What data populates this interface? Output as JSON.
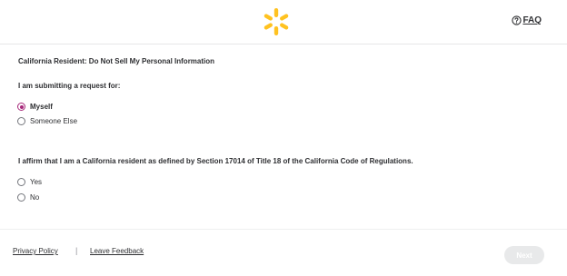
{
  "header": {
    "logo_icon": "walmart-spark-icon",
    "logo_color": "#ffc220",
    "faq_icon": "question-circle-icon",
    "faq_label": "FAQ"
  },
  "form": {
    "title": "California Resident: Do Not Sell My Personal Information",
    "request_question": "I am submitting a request for:",
    "request_options": [
      {
        "label": "Myself",
        "selected": true
      },
      {
        "label": "Someone Else",
        "selected": false
      }
    ],
    "affirm_question": "I affirm that I am a California resident as defined by Section 17014 of Title 18 of the California Code of Regulations.",
    "affirm_options": [
      {
        "label": "Yes",
        "selected": false
      },
      {
        "label": "No",
        "selected": false
      }
    ],
    "accent_color": "#a7287a"
  },
  "footer": {
    "privacy_policy": "Privacy Policy",
    "separator": "|",
    "leave_feedback": "Leave Feedback",
    "next_label": "Next",
    "next_disabled": true
  }
}
